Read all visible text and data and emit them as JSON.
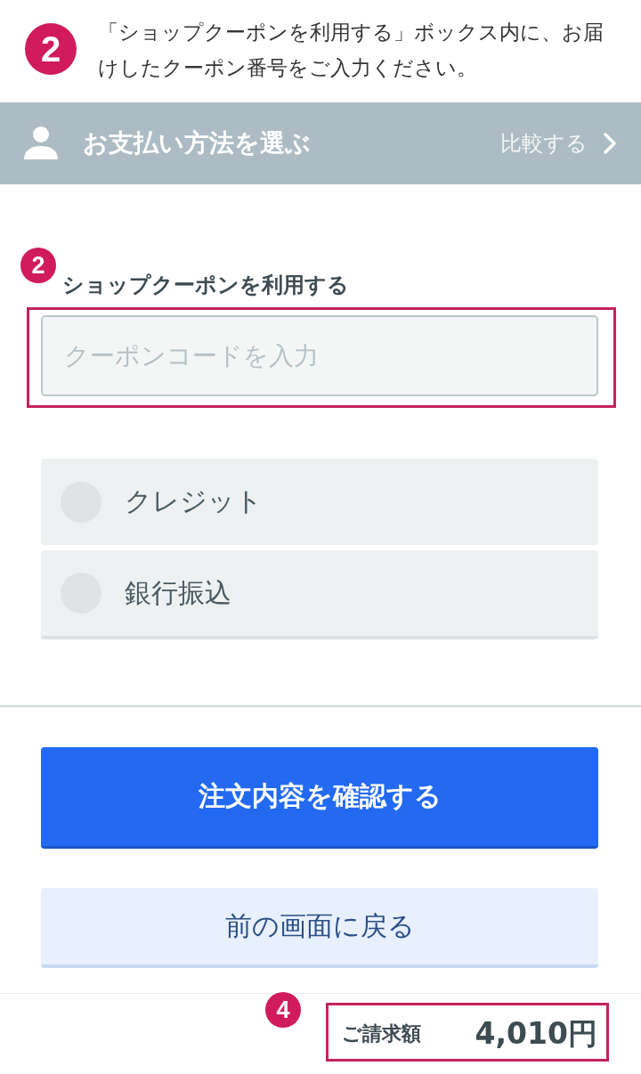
{
  "instruction": {
    "badge": "2",
    "text": "「ショップクーポンを利用する」ボックス内に、お届けしたクーポン番号をご入力ください。"
  },
  "header": {
    "title": "お支払い方法を選ぶ",
    "compare_link": "比較する"
  },
  "coupon": {
    "badge": "2",
    "label": "ショップクーポンを利用する",
    "placeholder": "クーポンコードを入力",
    "highlighted": true
  },
  "payment_options": [
    {
      "label": "クレジット",
      "selected": false
    },
    {
      "label": "銀行振込",
      "selected": false
    }
  ],
  "buttons": [
    {
      "kind": "primary",
      "label": "注文内容を確認する"
    },
    {
      "kind": "secondary",
      "label": "前の画面に戻る"
    }
  ],
  "total": {
    "badge": "4",
    "label": "ご請求額",
    "amount": "4,010円",
    "highlighted": true
  }
}
